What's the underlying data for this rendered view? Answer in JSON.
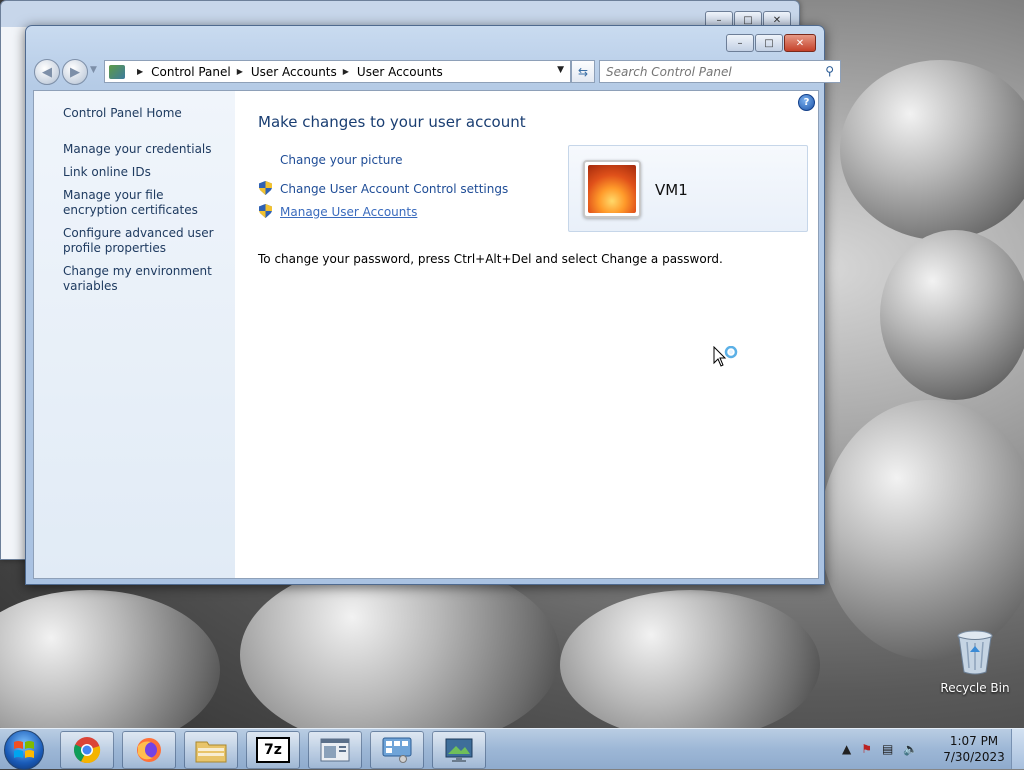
{
  "window": {
    "minimize_icon": "minimize-icon",
    "maximize_icon": "maximize-icon",
    "close_icon": "close-icon"
  },
  "address_bar": {
    "crumbs": [
      "Control Panel",
      "User Accounts",
      "User Accounts"
    ]
  },
  "search": {
    "placeholder": "Search Control Panel"
  },
  "sidebar": {
    "items": [
      {
        "label": "Control Panel Home"
      },
      {
        "label": "Manage your credentials"
      },
      {
        "label": "Link online IDs"
      },
      {
        "label": "Manage your file encryption certificates"
      },
      {
        "label": "Configure advanced user profile properties"
      },
      {
        "label": "Change my environment variables"
      }
    ]
  },
  "main": {
    "heading": "Make changes to your user account",
    "tasks": [
      {
        "label": "Change your picture"
      },
      {
        "label": "Change User Account Control settings"
      },
      {
        "label": "Manage User Accounts"
      }
    ],
    "password_note": "To change your password, press Ctrl+Alt+Del and select Change a password.",
    "user_name": "VM1"
  },
  "desktop": {
    "recycle_bin_label": "Recycle Bin"
  },
  "taskbar": {
    "pinned": [
      "chrome-icon",
      "firefox-icon",
      "file-explorer-icon",
      "7zip-icon",
      "app-window-icon",
      "control-panel-icon",
      "display-icon"
    ],
    "sevenzip_label": "7z",
    "time": "1:07 PM",
    "date": "7/30/2023"
  },
  "colors": {
    "link": "#1e4c96",
    "heading": "#1a3e72",
    "sidebar_bg": "#e7eff8",
    "taskbar": "#9db7d6"
  }
}
